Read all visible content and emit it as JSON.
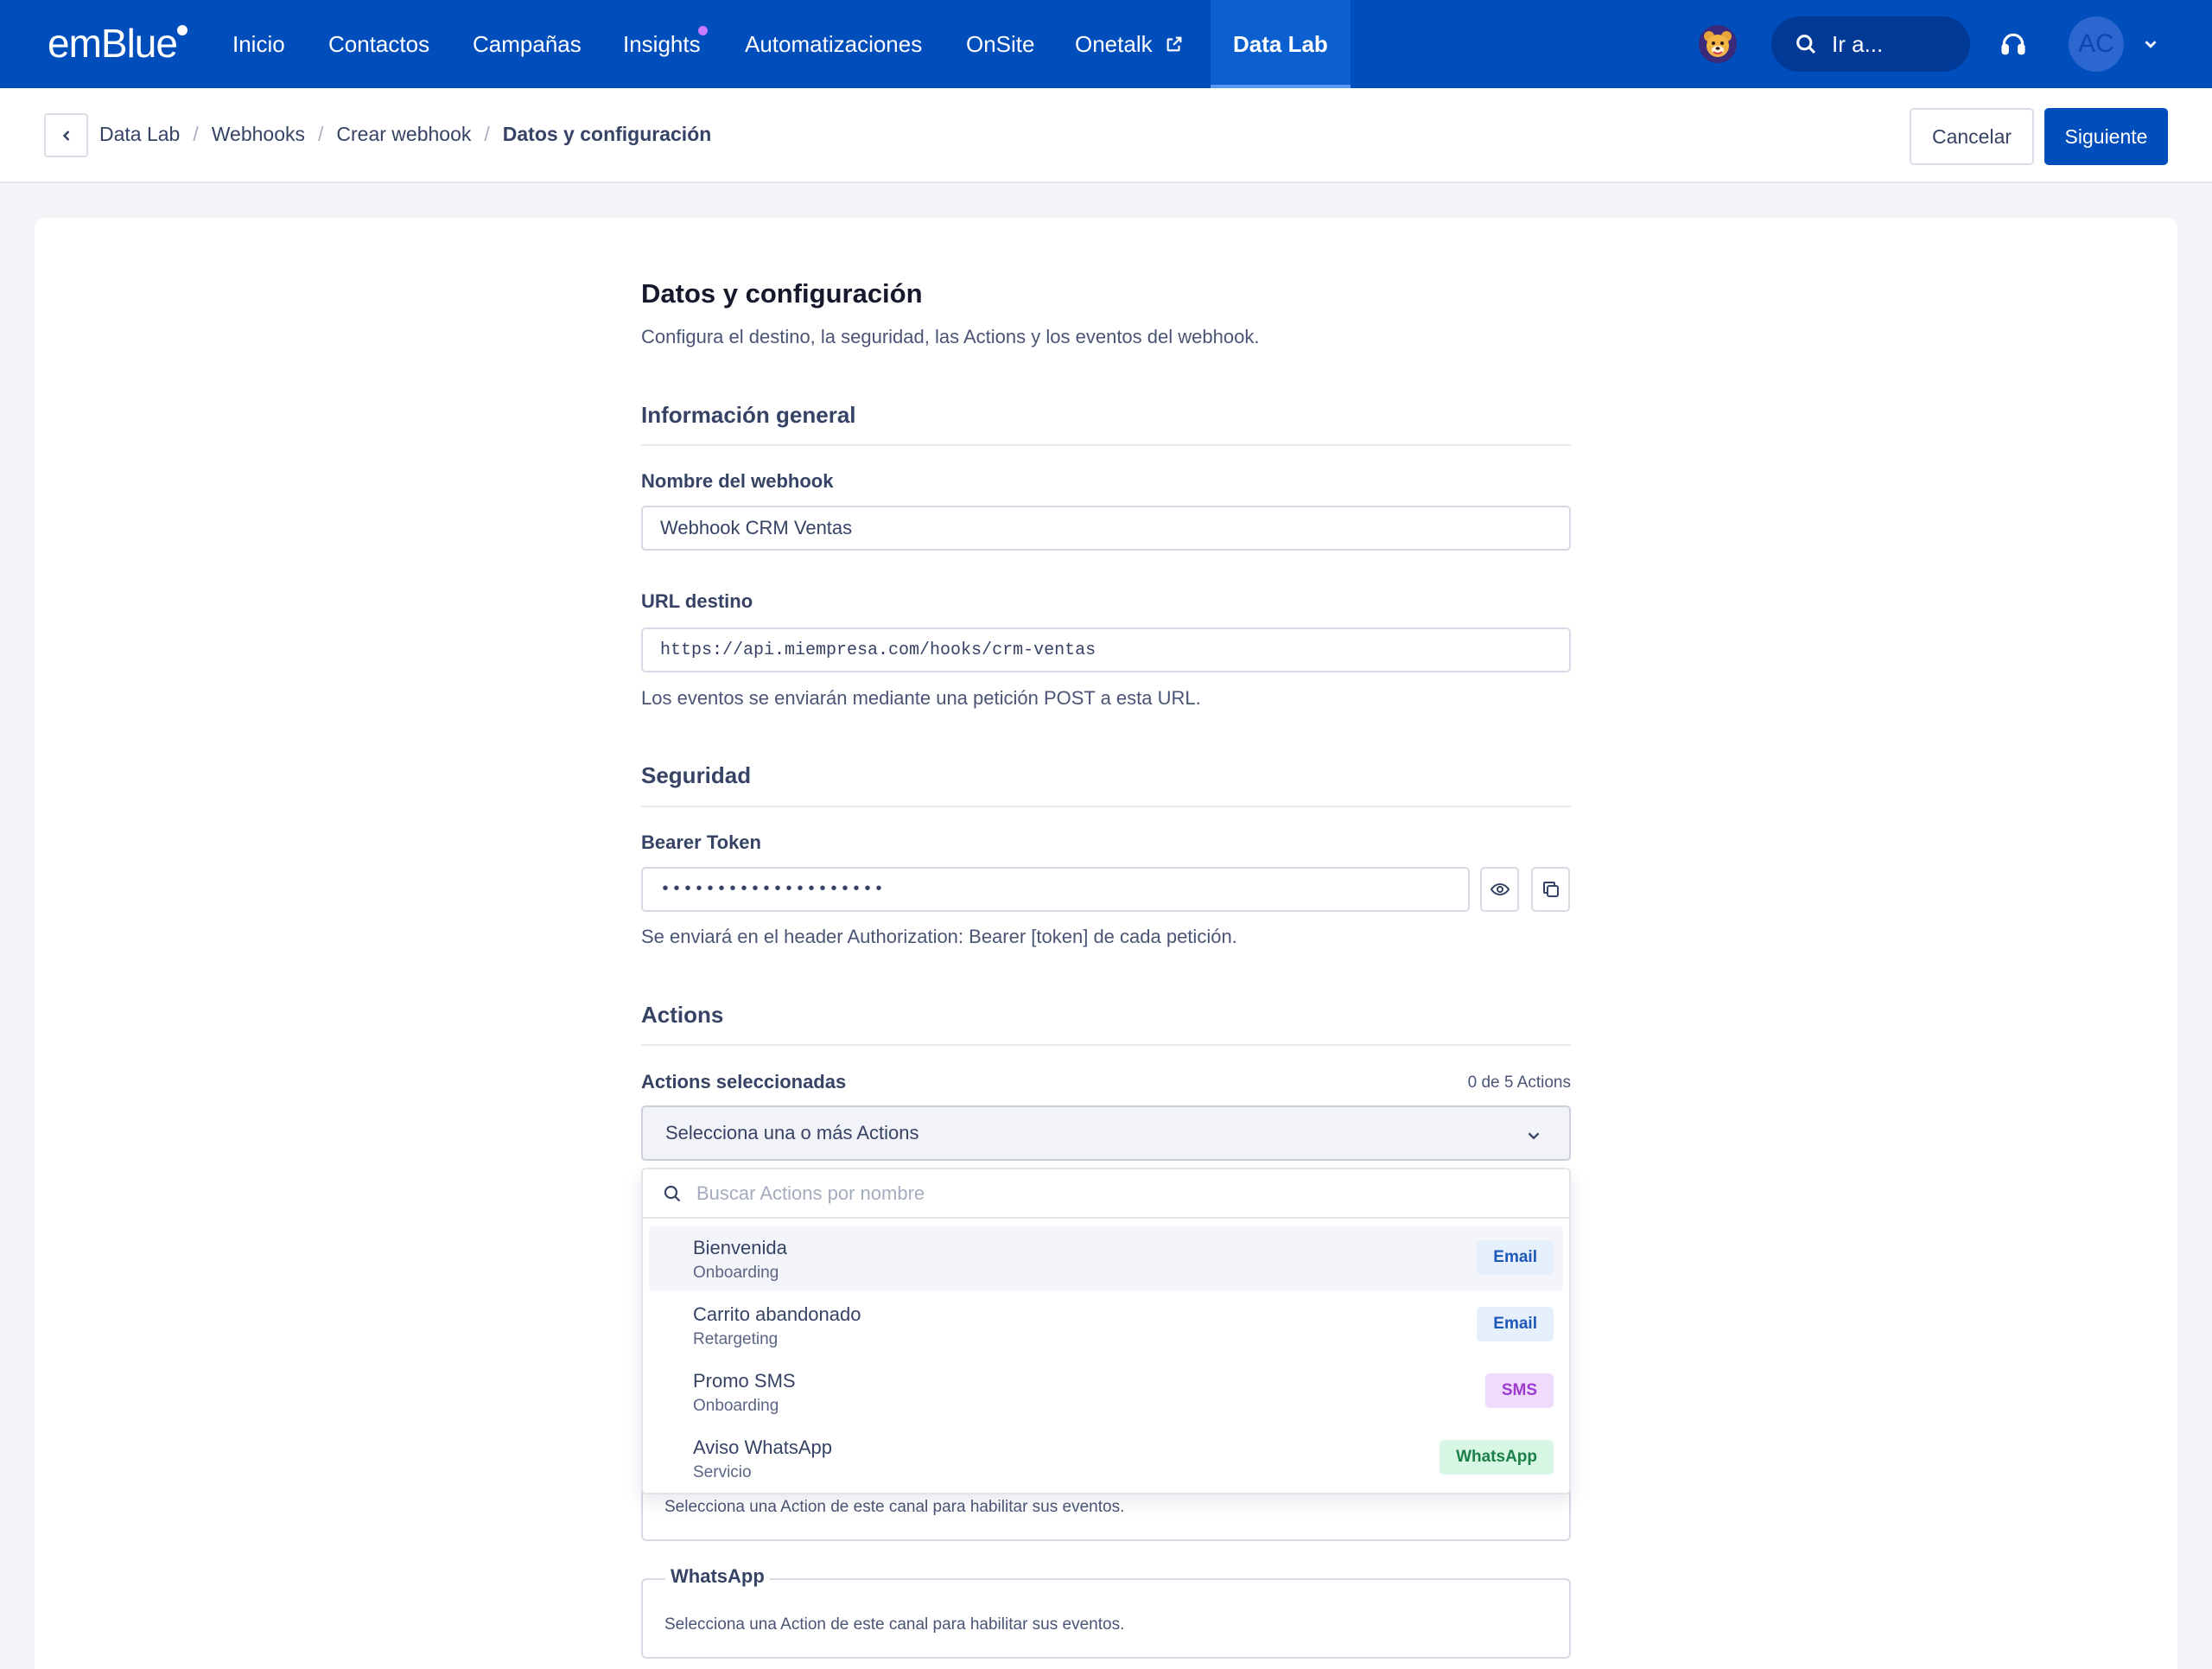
{
  "nav": {
    "logo": "emBlue",
    "items": [
      {
        "label": "Inicio"
      },
      {
        "label": "Contactos"
      },
      {
        "label": "Campañas"
      },
      {
        "label": "Insights"
      },
      {
        "label": "Automatizaciones"
      },
      {
        "label": "OnSite"
      },
      {
        "label": "Onetalk"
      },
      {
        "label": "Data Lab"
      }
    ],
    "active": "Data Lab",
    "search_label": "Ir a...",
    "avatar_initials": "AC",
    "colors": {
      "bar": "#004dbc",
      "active": "#0c5fcf",
      "notification_dot": "#c779ff"
    }
  },
  "breadcrumb": {
    "items": [
      "Data Lab",
      "Webhooks",
      "Crear webhook"
    ],
    "current": "Datos y configuración"
  },
  "actions": {
    "cancel_label": "Cancelar",
    "next_label": "Siguiente"
  },
  "page": {
    "title": "Datos y configuración",
    "subtitle": "Configura el destino, la seguridad, las Actions y los eventos del webhook."
  },
  "general": {
    "section_title": "Información general",
    "name_label": "Nombre del webhook",
    "name_value": "Webhook CRM Ventas",
    "url_label": "URL destino",
    "url_value": "https://api.miempresa.com/hooks/crm-ventas",
    "url_help": "Los eventos se enviarán mediante una petición POST a esta URL."
  },
  "security": {
    "section_title": "Seguridad",
    "token_label": "Bearer Token",
    "token_masked": "••••••••••••••••••••",
    "token_help": "Se enviará en el header Authorization: Bearer [token] de cada petición."
  },
  "actions_section": {
    "section_title": "Actions",
    "selected_label": "Actions seleccionadas",
    "counter": "0 de 5 Actions",
    "select_placeholder": "Selecciona una o más Actions",
    "search_placeholder": "Buscar Actions por nombre",
    "options": [
      {
        "name": "Bienvenida",
        "category": "Onboarding",
        "channel": "Email"
      },
      {
        "name": "Carrito abandonado",
        "category": "Retargeting",
        "channel": "Email"
      },
      {
        "name": "Promo SMS",
        "category": "Onboarding",
        "channel": "SMS"
      },
      {
        "name": "Aviso WhatsApp",
        "category": "Servicio",
        "channel": "WhatsApp"
      }
    ]
  },
  "channels": {
    "hidden_channel_help": "Selecciona una Action de este canal para habilitar sus eventos.",
    "whatsapp": {
      "legend": "WhatsApp",
      "help": "Selecciona una Action de este canal para habilitar sus eventos."
    }
  }
}
